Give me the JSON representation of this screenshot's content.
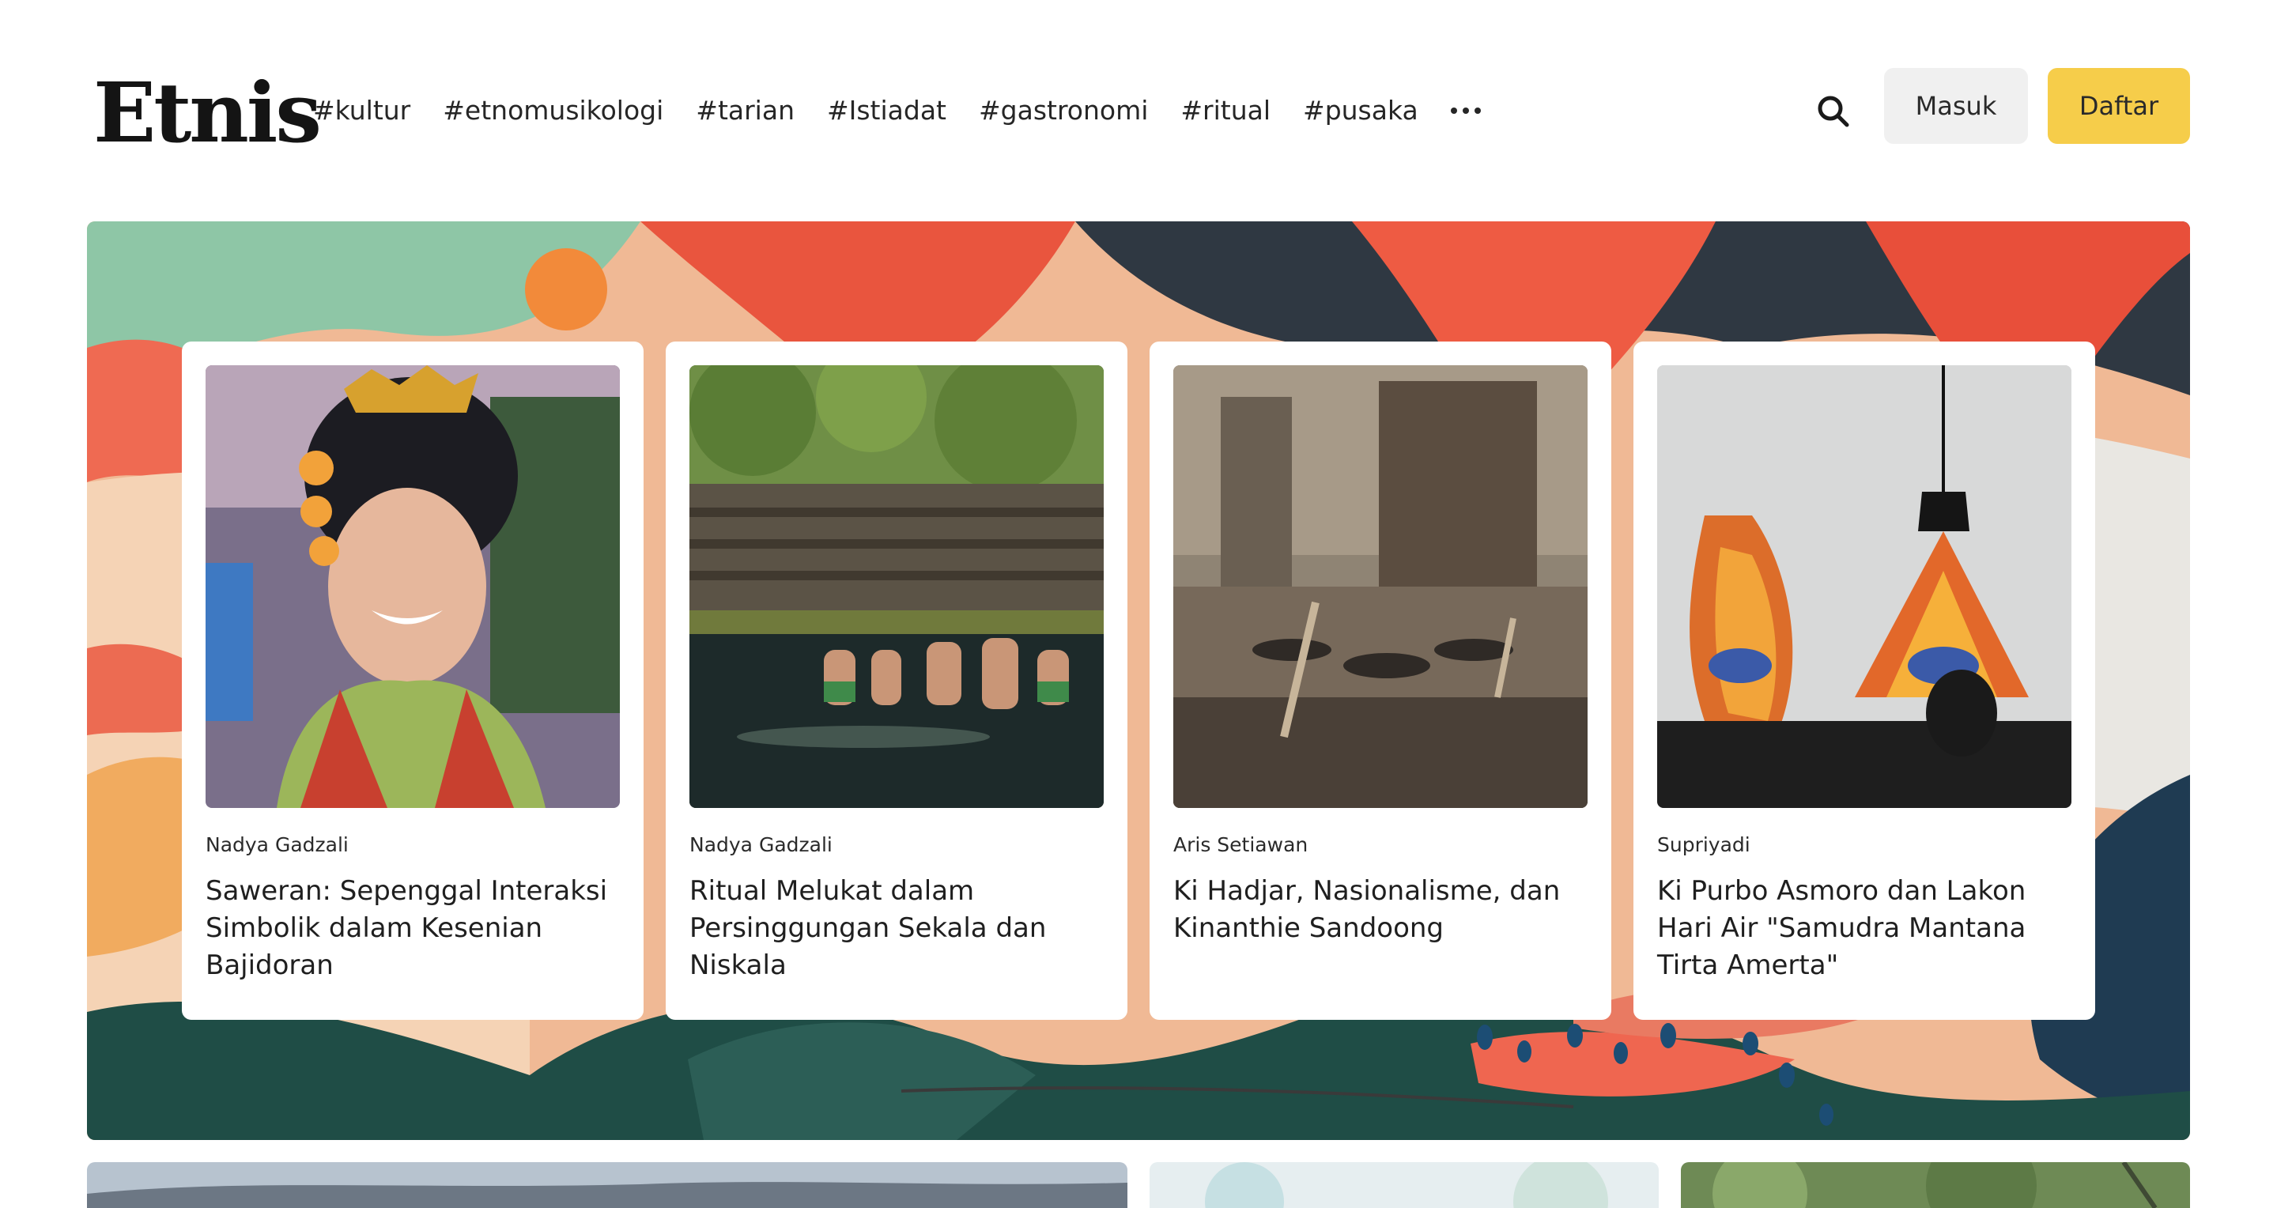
{
  "brand": {
    "logo_text": "Etnis"
  },
  "nav": {
    "items": [
      "#kultur",
      "#etnomusikologi",
      "#tarian",
      "#Istiadat",
      "#gastronomi",
      "#ritual",
      "#pusaka"
    ],
    "more_icon": "more-horizontal-icon"
  },
  "header": {
    "search_icon": "search-icon",
    "login_label": "Masuk",
    "register_label": "Daftar"
  },
  "featured": [
    {
      "author": "Nadya Gadzali",
      "title": "Saweran: Sepenggal Interaksi Simbolik dalam Kesenian Bajidoran"
    },
    {
      "author": "Nadya Gadzali",
      "title": "Ritual Melukat dalam Persinggungan Sekala dan Niskala"
    },
    {
      "author": "Aris Setiawan",
      "title": "Ki Hadjar, Nasionalisme, dan Kinanthie Sandoong"
    },
    {
      "author": "Supriyadi",
      "title": "Ki Purbo Asmoro dan Lakon Hari Air \"Samudra Mantana Tirta Amerta\""
    }
  ],
  "colors": {
    "accent": "#f6cd4a",
    "login_bg": "#f0f0f0",
    "text": "#1f1f1f"
  }
}
